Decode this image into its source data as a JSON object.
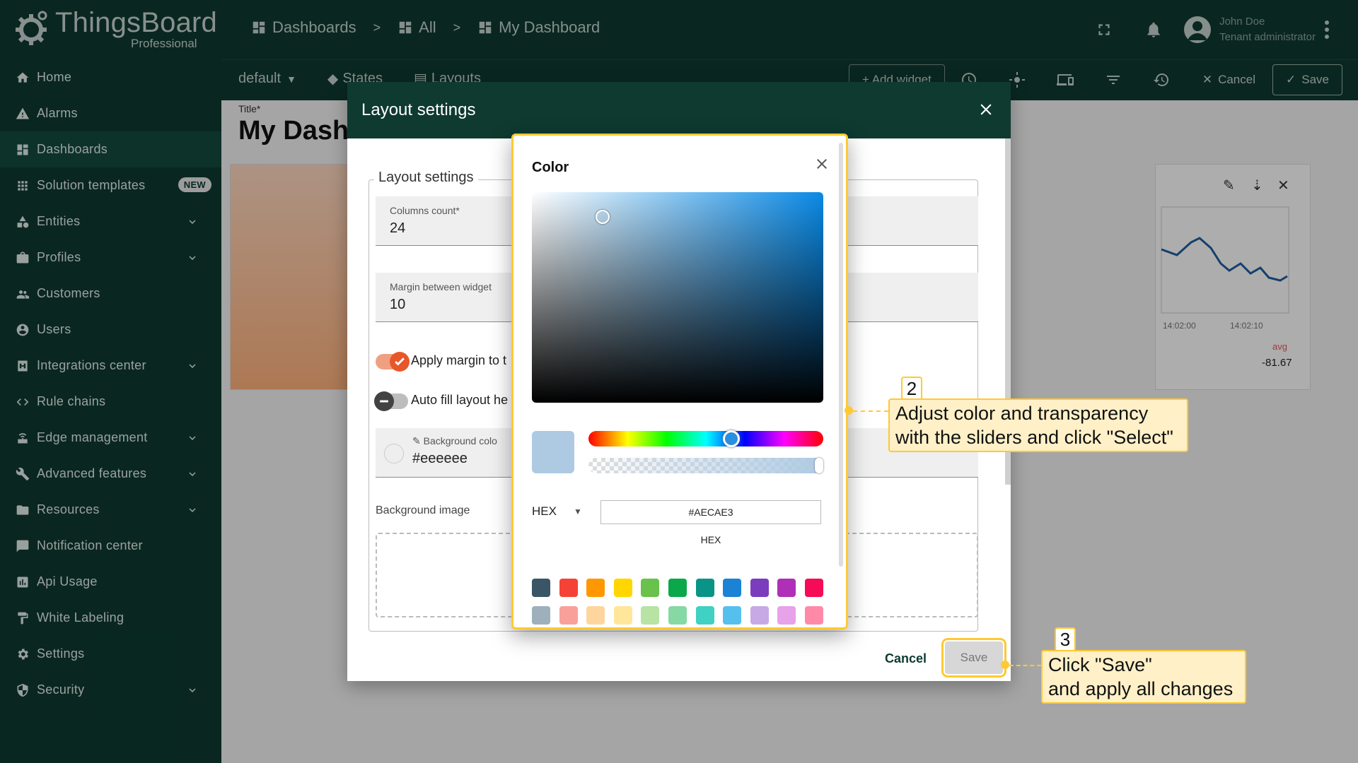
{
  "app": {
    "name": "ThingsBoard",
    "edition": "Professional"
  },
  "sidebar": {
    "items": [
      {
        "label": "Home",
        "icon": "home-icon",
        "chevron": false
      },
      {
        "label": "Alarms",
        "icon": "warning-icon",
        "chevron": false
      },
      {
        "label": "Dashboards",
        "icon": "dashboard-icon",
        "chevron": false,
        "active": true
      },
      {
        "label": "Solution templates",
        "icon": "apps-icon",
        "chevron": false,
        "badge": "NEW"
      },
      {
        "label": "Entities",
        "icon": "category-icon",
        "chevron": true
      },
      {
        "label": "Profiles",
        "icon": "briefcase-icon",
        "chevron": true
      },
      {
        "label": "Customers",
        "icon": "supervisor-icon",
        "chevron": false
      },
      {
        "label": "Users",
        "icon": "account-icon",
        "chevron": false
      },
      {
        "label": "Integrations center",
        "icon": "integration-icon",
        "chevron": true
      },
      {
        "label": "Rule chains",
        "icon": "code-icon",
        "chevron": false
      },
      {
        "label": "Edge management",
        "icon": "router-icon",
        "chevron": true
      },
      {
        "label": "Advanced features",
        "icon": "build-icon",
        "chevron": true
      },
      {
        "label": "Resources",
        "icon": "folder-icon",
        "chevron": true
      },
      {
        "label": "Notification center",
        "icon": "notification-icon",
        "chevron": false
      },
      {
        "label": "Api Usage",
        "icon": "chart-icon",
        "chevron": false
      },
      {
        "label": "White Labeling",
        "icon": "format-paint-icon",
        "chevron": false
      },
      {
        "label": "Settings",
        "icon": "settings-icon",
        "chevron": false
      },
      {
        "label": "Security",
        "icon": "security-icon",
        "chevron": true
      }
    ]
  },
  "breadcrumbs": [
    "Dashboards",
    "All",
    "My Dashboard"
  ],
  "user": {
    "name": "John Doe",
    "role": "Tenant administrator"
  },
  "toolbar": {
    "state": "default",
    "states": "States",
    "layouts": "Layouts",
    "add_widget": "+ Add widget",
    "cancel": "Cancel",
    "save": "Save"
  },
  "dashboard": {
    "title_label": "Title*",
    "title": "My Dash"
  },
  "chart_widget": {
    "ticks": [
      "14:02:00",
      "14:02:10"
    ],
    "legend": "avg",
    "value": "-81.67"
  },
  "layout_dialog": {
    "title": "Layout settings",
    "section": "Layout settings",
    "columns_label": "Columns count*",
    "columns_value": "24",
    "margin_label": "Margin between widget",
    "margin_value": "10",
    "apply_margin": "Apply margin to t",
    "auto_fill": "Auto fill layout he",
    "bg_color_label": "Background colo",
    "bg_color_value": "#eeeeee",
    "bg_image_label": "Background image",
    "cancel": "Cancel",
    "save": "Save"
  },
  "color_picker": {
    "title": "Color",
    "format": "HEX",
    "hex_value": "#AECAE3",
    "hex_caption": "HEX",
    "selected_color": "#aecae3",
    "swatches_row1": [
      "#3a5566",
      "#f44336",
      "#ff9800",
      "#ffd600",
      "#69c24b",
      "#0ba84a",
      "#0a9488",
      "#1a83d6",
      "#7b3dbd",
      "#b02fb8",
      "#f50b57"
    ],
    "swatches_row2": [
      "#9db0bc",
      "#f9a09a",
      "#ffd59e",
      "#ffe69a",
      "#b7e3a5",
      "#86d9a4",
      "#3fd1c3",
      "#55c0ee",
      "#c7a9e6",
      "#e7a2e9",
      "#ff8aa8"
    ]
  },
  "callouts": {
    "step2_num": "2",
    "step2_text": "Adjust color and transparency with the sliders and click \"Select\"",
    "step3_num": "3",
    "step3_line1": "Click \"Save\"",
    "step3_line2": "and apply all changes"
  }
}
